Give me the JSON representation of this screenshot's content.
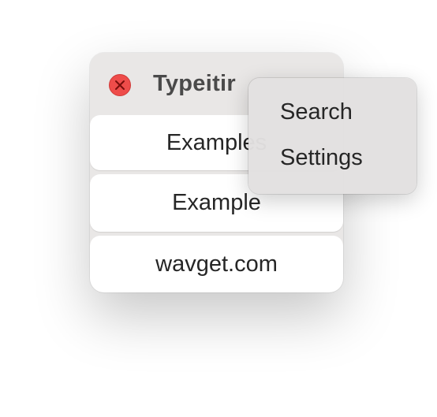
{
  "window": {
    "title": "Typeitir"
  },
  "list": {
    "items": [
      {
        "label": "Examples"
      },
      {
        "label": "Example"
      },
      {
        "label": "wavget.com"
      }
    ]
  },
  "context_menu": {
    "items": [
      {
        "label": "Search"
      },
      {
        "label": "Settings"
      }
    ]
  },
  "icons": {
    "close": "close-icon"
  },
  "colors": {
    "close_button": "#ee4c4a",
    "panel_background": "#e9e7e6",
    "menu_background": "#e2e0e0"
  }
}
